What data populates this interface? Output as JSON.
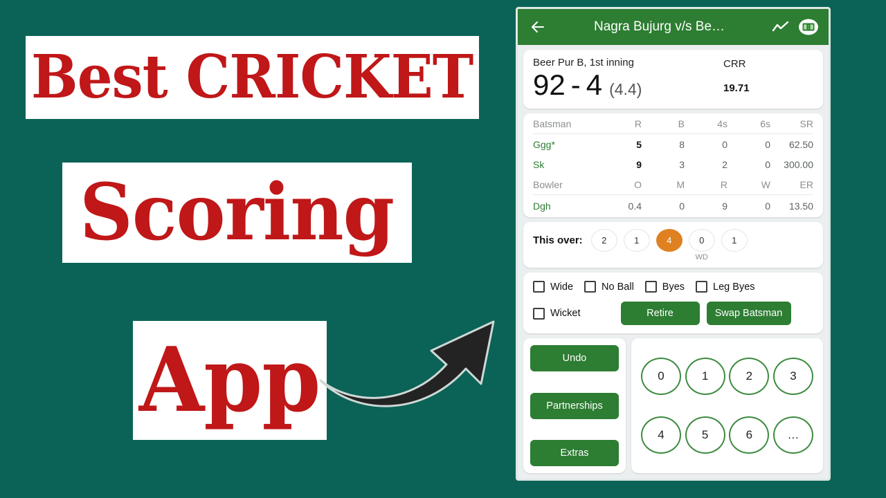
{
  "promo": {
    "line1": "Best CRICKET",
    "line2": "Scoring",
    "line3": "App",
    "text_color": "#c01718",
    "background_color": "#0a6356"
  },
  "app": {
    "bar": {
      "back_icon": "back-arrow-icon",
      "title": "Nagra Bujurg v/s Be…",
      "chart_icon": "trending-line-icon",
      "scoreboard_icon": "scoreboard-icon",
      "scoreboard_icon_text": "1:3",
      "color": "#2d7d32"
    },
    "score": {
      "team_inning": "Beer Pur B, 1st inning",
      "runs": "92",
      "dash": "-",
      "wickets": "4",
      "overs": "(4.4)",
      "crr_label": "CRR",
      "crr_value": "19.71"
    },
    "batsman_table": {
      "headers": [
        "Batsman",
        "R",
        "B",
        "4s",
        "6s",
        "SR"
      ],
      "rows": [
        {
          "name": "Ggg*",
          "r": "5",
          "b": "8",
          "fours": "0",
          "sixes": "0",
          "sr": "62.50"
        },
        {
          "name": "Sk",
          "r": "9",
          "b": "3",
          "fours": "2",
          "sixes": "0",
          "sr": "300.00"
        }
      ]
    },
    "bowler_table": {
      "headers": [
        "Bowler",
        "O",
        "M",
        "R",
        "W",
        "ER"
      ],
      "rows": [
        {
          "name": "Dgh",
          "o": "0.4",
          "m": "0",
          "r": "9",
          "w": "0",
          "er": "13.50"
        }
      ]
    },
    "this_over": {
      "label": "This over:",
      "balls": [
        {
          "value": "2",
          "tag": "",
          "highlight": false
        },
        {
          "value": "1",
          "tag": "",
          "highlight": false
        },
        {
          "value": "4",
          "tag": "",
          "highlight": true
        },
        {
          "value": "0",
          "tag": "WD",
          "highlight": false
        },
        {
          "value": "1",
          "tag": "",
          "highlight": false
        }
      ],
      "highlight_color": "#df8120"
    },
    "extras": {
      "checkboxes": [
        "Wide",
        "No Ball",
        "Byes",
        "Leg Byes"
      ],
      "wicket_label": "Wicket",
      "retire_label": "Retire",
      "swap_label": "Swap Batsman"
    },
    "actions": {
      "undo": "Undo",
      "partnerships": "Partnerships",
      "extras": "Extras"
    },
    "numpad": {
      "row1": [
        "0",
        "1",
        "2",
        "3"
      ],
      "row2": [
        "4",
        "5",
        "6",
        "…"
      ]
    }
  }
}
